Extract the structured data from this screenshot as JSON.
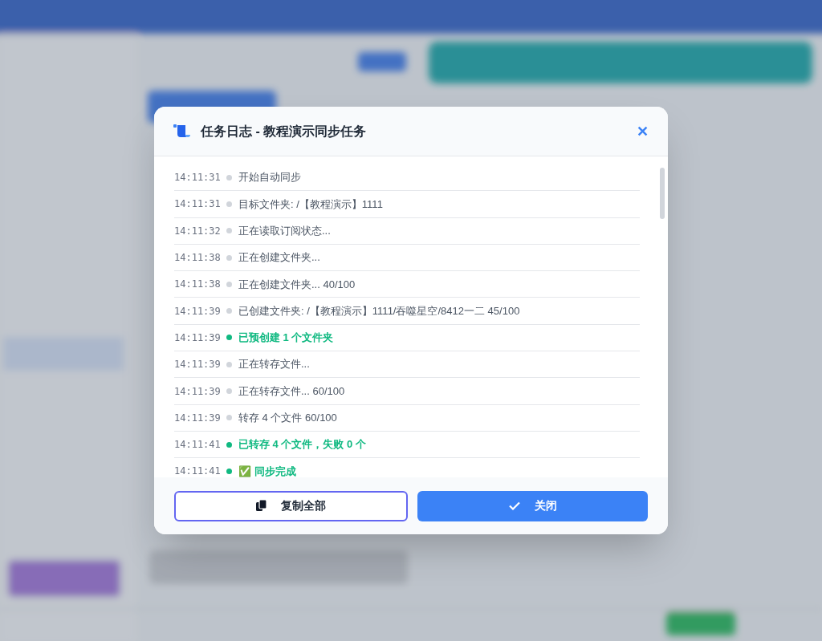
{
  "dialog": {
    "title": "任务日志 - 教程演示同步任务",
    "close_symbol": "✕"
  },
  "log": [
    {
      "time": "14:11:31",
      "kind": "info",
      "message": "开始自动同步"
    },
    {
      "time": "14:11:31",
      "kind": "info",
      "message": "目标文件夹: /【教程演示】1111"
    },
    {
      "time": "14:11:32",
      "kind": "info",
      "message": "正在读取订阅状态..."
    },
    {
      "time": "14:11:38",
      "kind": "info",
      "message": "正在创建文件夹..."
    },
    {
      "time": "14:11:38",
      "kind": "info",
      "message": "正在创建文件夹... 40/100"
    },
    {
      "time": "14:11:39",
      "kind": "info",
      "message": "已创建文件夹: /【教程演示】1111/吞噬星空/8412一二 45/100"
    },
    {
      "time": "14:11:39",
      "kind": "success",
      "message": "已预创建 1 个文件夹"
    },
    {
      "time": "14:11:39",
      "kind": "info",
      "message": "正在转存文件..."
    },
    {
      "time": "14:11:39",
      "kind": "info",
      "message": "正在转存文件... 60/100"
    },
    {
      "time": "14:11:39",
      "kind": "info",
      "message": "转存 4 个文件 60/100"
    },
    {
      "time": "14:11:41",
      "kind": "success",
      "message": "已转存 4 个文件，失败 0 个"
    },
    {
      "time": "14:11:41",
      "kind": "success",
      "message": "✅ 同步完成"
    }
  ],
  "buttons": [
    {
      "label": "复制全部",
      "kind": "copy"
    },
    {
      "label": "关闭",
      "kind": "close"
    }
  ]
}
